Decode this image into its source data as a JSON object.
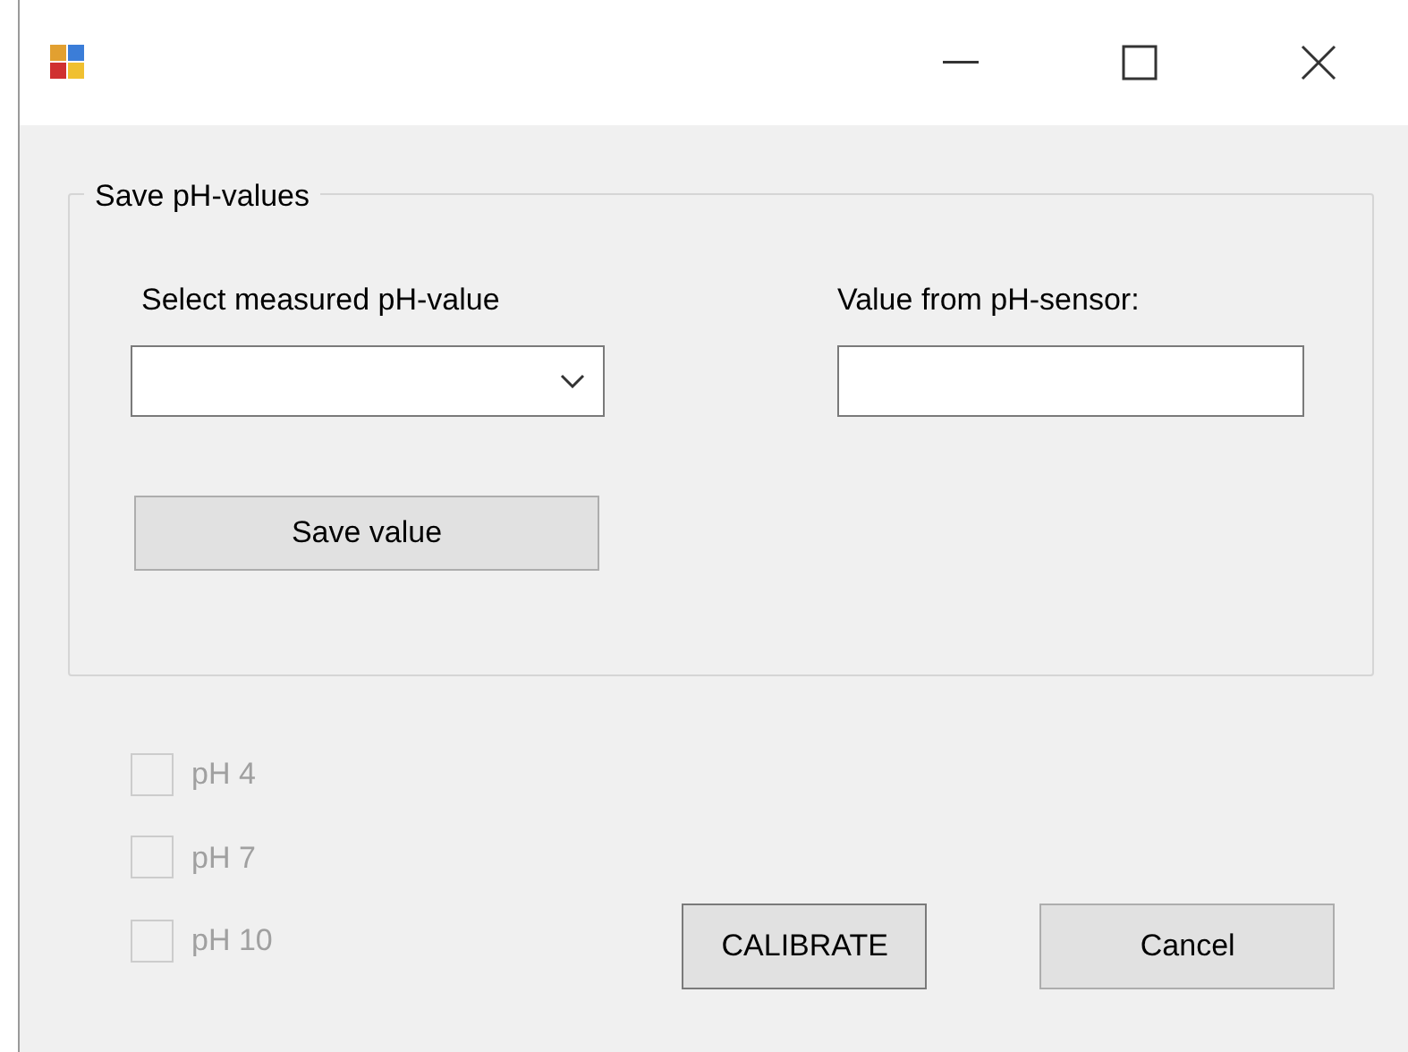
{
  "window": {
    "controls": [
      {
        "kind": "minimize"
      },
      {
        "kind": "maximize"
      },
      {
        "kind": "close"
      }
    ]
  },
  "group": {
    "title": "Save pH-values",
    "select_label": "Select measured pH-value",
    "sensor_label": "Value from pH-sensor:",
    "save_button": "Save value"
  },
  "checkboxes": [
    {
      "label": "pH 4",
      "checked": false,
      "disabled": true
    },
    {
      "label": "pH 7",
      "checked": false,
      "disabled": true
    },
    {
      "label": "pH 10",
      "checked": false,
      "disabled": true
    }
  ],
  "buttons": [
    {
      "label": "CALIBRATE",
      "selected": true
    },
    {
      "label": "Cancel",
      "selected": false
    }
  ]
}
